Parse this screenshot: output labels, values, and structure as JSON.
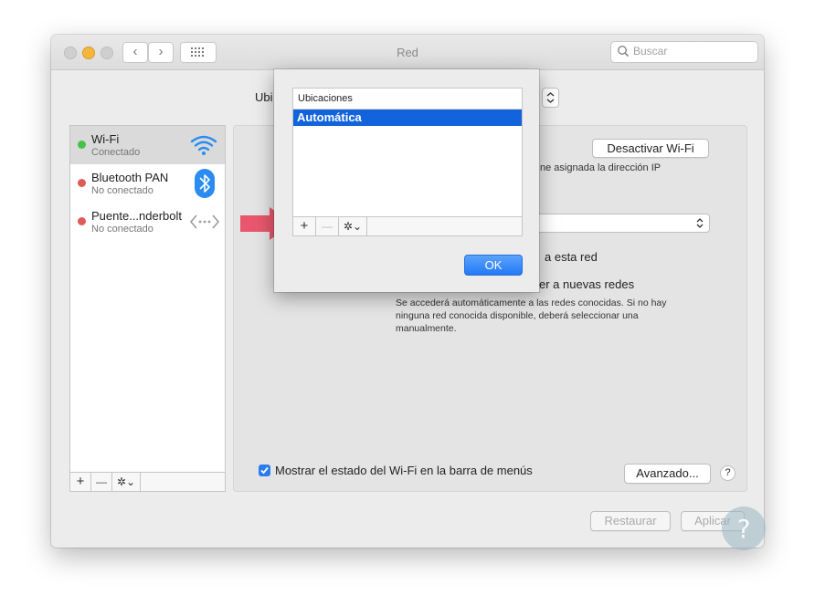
{
  "window": {
    "title": "Red",
    "search": {
      "placeholder": "Buscar"
    },
    "nav": {
      "back": "‹",
      "forward": "›"
    }
  },
  "location_label_visible": "Ubi",
  "sidebar": {
    "items": [
      {
        "name": "Wi-Fi",
        "status": "Conectado",
        "dot_color": "#45c14a",
        "icon": "wifi-icon",
        "selected": true
      },
      {
        "name": "Bluetooth PAN",
        "status": "No conectado",
        "dot_color": "#e05a5a",
        "icon": "bluetooth-icon",
        "selected": false
      },
      {
        "name": "Puente...nderbolt",
        "status": "No conectado",
        "dot_color": "#e05a5a",
        "icon": "thunderbolt-bridge-icon",
        "selected": false
      }
    ],
    "toolbar": {
      "add": "+",
      "remove": "—",
      "gear": "✲⌄"
    }
  },
  "panel": {
    "turn_off_button": "Desactivar Wi-Fi",
    "ip_text_fragment": "ne asignada la dirección IP",
    "join_text_fragment": "a esta red",
    "ask_text_fragment": "er a nuevas redes",
    "ask_description": "Se accederá automáticamente a las redes conocidas. Si no hay ninguna red conocida disponible, deberá seleccionar una manualmente.",
    "show_status_label": "Mostrar el estado del Wi-Fi en la barra de menús",
    "show_status_checked": true,
    "advanced_button": "Avanzado...",
    "help_button": "?"
  },
  "footer": {
    "revert_button": "Restaurar",
    "apply_button": "Aplicar"
  },
  "sheet": {
    "column_header": "Ubicaciones",
    "locations": [
      "Automática"
    ],
    "toolbar": {
      "add": "+",
      "remove": "—",
      "gear": "✲⌄"
    },
    "ok_button": "OK"
  },
  "colors": {
    "accent": "#1263dc",
    "arrow": "#e8475f"
  }
}
